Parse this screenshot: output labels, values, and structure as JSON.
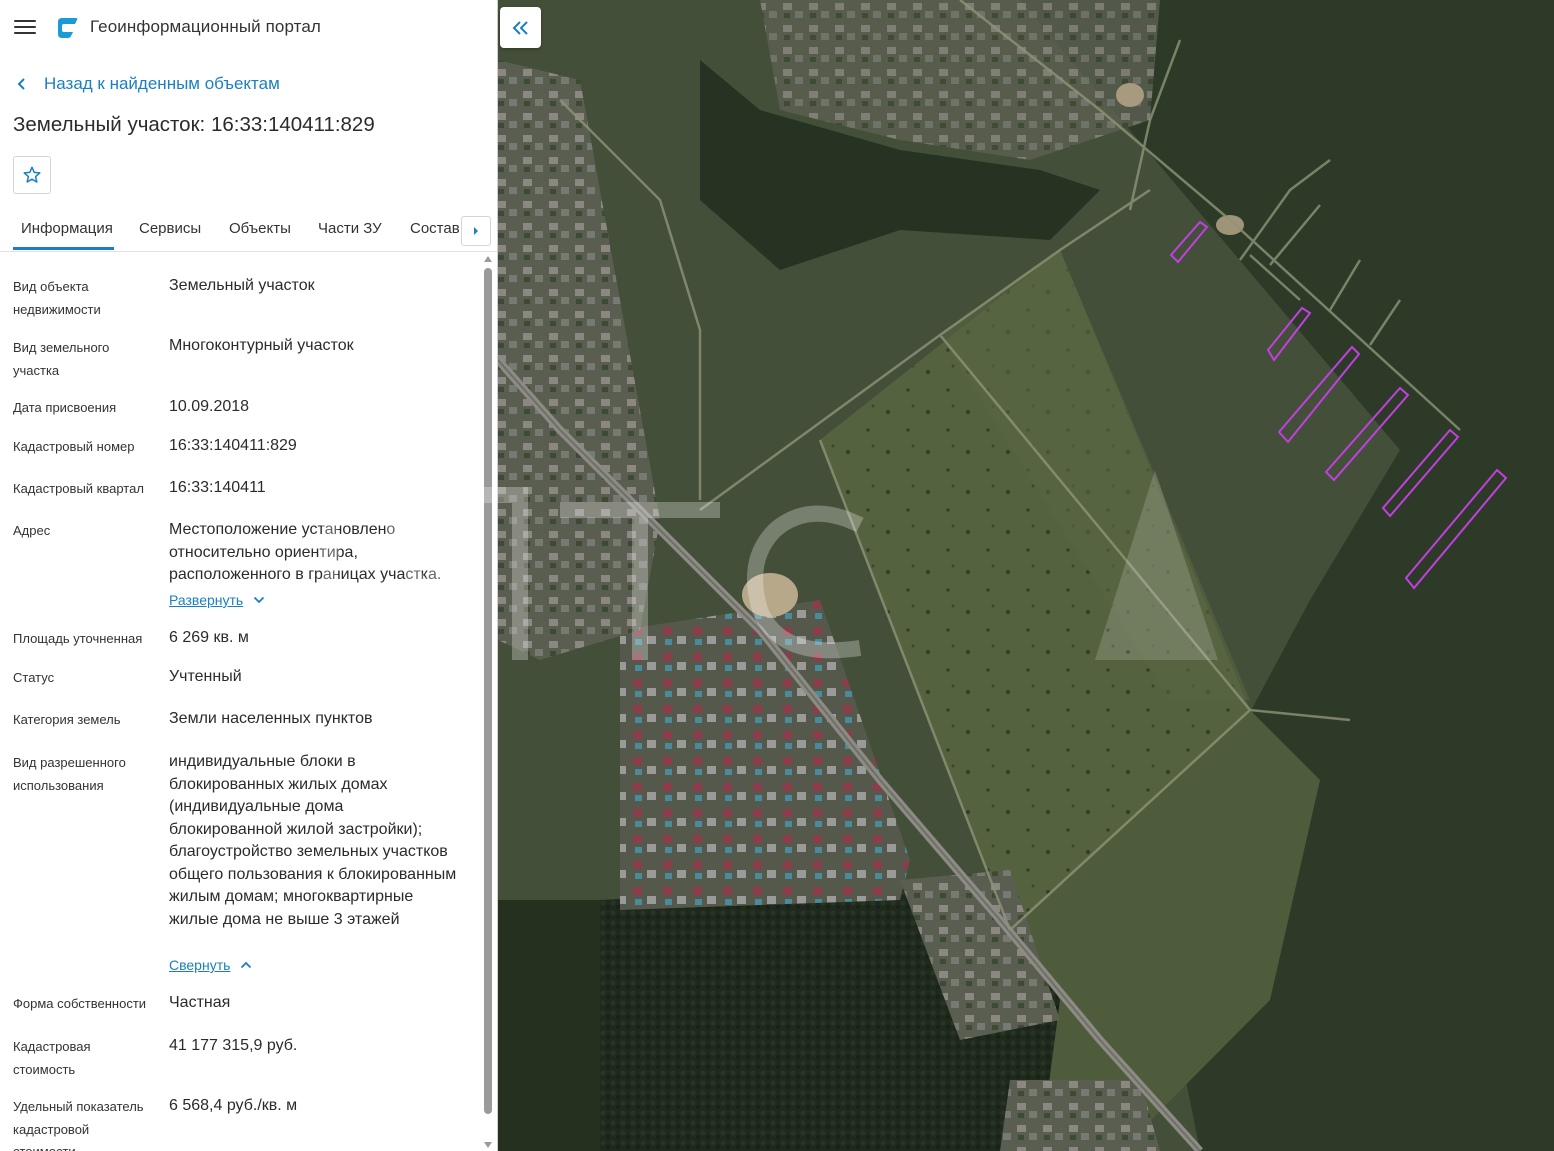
{
  "header": {
    "menu_icon": "hamburger-menu-icon",
    "logo_icon": "portal-logo-icon",
    "title": "Геоинформационный портал"
  },
  "navigation": {
    "back_label": "Назад к найденным объектам"
  },
  "object": {
    "title": "Земельный участок: 16:33:140411:829",
    "favorite_icon": "star-icon"
  },
  "tabs": [
    {
      "label": "Информация",
      "active": true
    },
    {
      "label": "Сервисы",
      "active": false
    },
    {
      "label": "Объекты",
      "active": false
    },
    {
      "label": "Части ЗУ",
      "active": false
    },
    {
      "label": "Состав",
      "active": false
    }
  ],
  "info": {
    "object_type_label": "Вид объекта недвижимости",
    "object_type_value": "Земельный участок",
    "land_type_label": "Вид земельного участка",
    "land_type_value": "Многоконтурный участок",
    "assign_date_label": "Дата присвоения",
    "assign_date_value": "10.09.2018",
    "cadastral_number_label": "Кадастровый номер",
    "cadastral_number_value": "16:33:140411:829",
    "cadastral_quarter_label": "Кадастровый квартал",
    "cadastral_quarter_value": "16:33:140411",
    "address_label": "Адрес",
    "address_value": "Местоположение установлено относительно ориентира, расположенного в границах участка.",
    "address_expand": "Развернуть",
    "area_label": "Площадь уточненная",
    "area_value": "6 269 кв. м",
    "status_label": "Статус",
    "status_value": "Учтенный",
    "category_label": "Категория земель",
    "category_value": "Земли населенных пунктов",
    "permitted_use_label": "Вид разрешенного использования",
    "permitted_use_value": "индивидуальные блоки в блокированных жилых домах (индивидуальные дома блокированной жилой застройки); благоустройство земельных участков общего пользования к блокированным жилым домам; многоквартирные жилые дома не выше 3 этажей",
    "permitted_use_collapse": "Свернуть",
    "ownership_label": "Форма собственности",
    "ownership_value": "Частная",
    "cadastral_value_label": "Кадастровая стоимость",
    "cadastral_value_value": "41 177 315,9 руб.",
    "specific_value_label": "Удельный показатель кадастровой стоимости",
    "specific_value_value": "6 568,4 руб./кв. м"
  },
  "map": {
    "collapse_icon": "double-chevron-left-icon",
    "parcel_color": "#c040e0"
  },
  "colors": {
    "accent": "#1a7fc4"
  }
}
